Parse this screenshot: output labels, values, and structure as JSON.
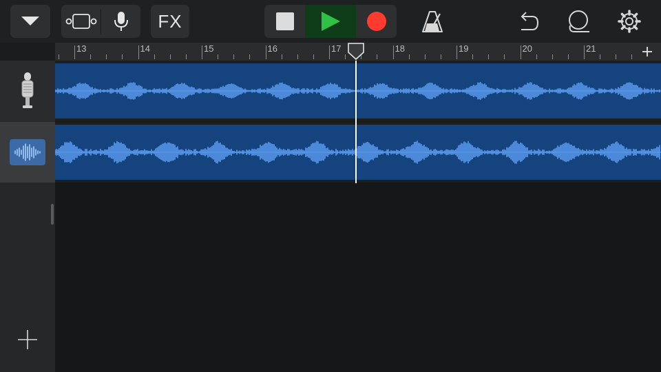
{
  "toolbar": {
    "menu_icon": "chevron-down-icon",
    "tracks_view_icon": "tracks-view-icon",
    "mic_icon": "microphone-icon",
    "fx_label": "FX",
    "transport": {
      "stop_icon": "stop-icon",
      "play_icon": "play-icon",
      "record_icon": "record-icon"
    },
    "metronome_icon": "metronome-icon",
    "undo_icon": "undo-icon",
    "loop_icon": "loop-icon",
    "settings_icon": "gear-icon"
  },
  "ruler": {
    "bars": [
      "13",
      "14",
      "15",
      "16",
      "17",
      "18",
      "19",
      "20",
      "21"
    ],
    "add_section_icon": "plus-icon"
  },
  "playhead_bar": 17.4,
  "tracks": [
    {
      "name": "Microphone track",
      "icon": "microphone-icon"
    },
    {
      "name": "Audio track",
      "icon": "waveform-icon"
    }
  ],
  "add_track_icon": "plus-icon",
  "colors": {
    "region": "#14437e",
    "waveform": "#5b9cf0",
    "play_active": "#1d9a35",
    "record": "#ff3b30"
  }
}
